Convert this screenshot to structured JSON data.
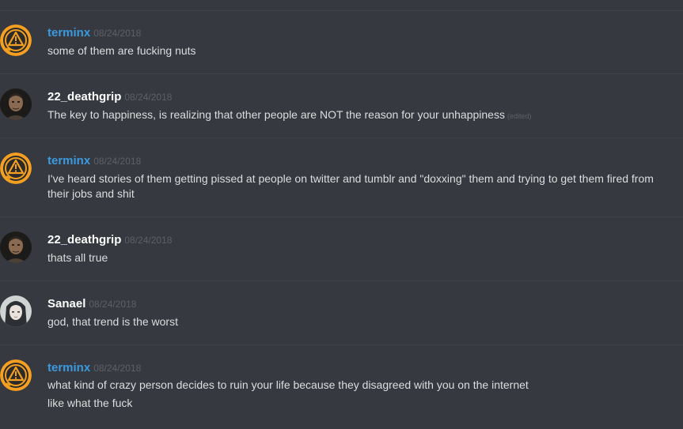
{
  "colors": {
    "background": "#36393f",
    "terminx": "#3c9ae0",
    "default_user": "#ffffff",
    "text": "#dcddde",
    "timestamp": "#5d6067"
  },
  "messages": [
    {
      "user": "terminx",
      "avatar": "warning-orange-icon",
      "time": "08/24/2018",
      "lines": [
        "some of them are fucking nuts"
      ]
    },
    {
      "user": "22_deathgrip",
      "avatar": "soldier-portrait",
      "time": "08/24/2018",
      "lines": [
        "The key to happiness, is realizing that other people are NOT the reason for your unhappiness"
      ],
      "edited": "(edited)"
    },
    {
      "user": "terminx",
      "avatar": "warning-orange-icon",
      "time": "08/24/2018",
      "lines": [
        "I've heard stories of them getting pissed at people on twitter and tumblr and \"doxxing\" them and trying to get them fired from their jobs and shit"
      ]
    },
    {
      "user": "22_deathgrip",
      "avatar": "soldier-portrait",
      "time": "08/24/2018",
      "lines": [
        "thats all true"
      ]
    },
    {
      "user": "Sanael",
      "avatar": "anime-girl-portrait",
      "time": "08/24/2018",
      "lines": [
        "god, that trend is the worst"
      ]
    },
    {
      "user": "terminx",
      "avatar": "warning-orange-icon",
      "time": "08/24/2018",
      "lines": [
        "what kind of crazy person decides to ruin your life because they disagreed with you on the internet",
        "like what the fuck"
      ]
    }
  ]
}
